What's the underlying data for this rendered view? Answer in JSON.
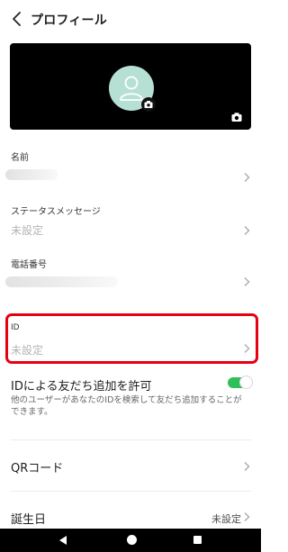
{
  "header": {
    "title": "プロフィール"
  },
  "profile": {
    "name": {
      "label": "名前"
    },
    "status": {
      "label": "ステータスメッセージ",
      "value": "未設定"
    },
    "phone": {
      "label": "電話番号"
    },
    "id": {
      "label": "ID",
      "value": "未設定"
    },
    "allow_id_search": {
      "label": "IDによる友だち追加を許可",
      "description": "他のユーザーがあなたのIDを検索して友だち追加することができます。",
      "enabled": true
    },
    "qr": {
      "label": "QRコード"
    },
    "birthday": {
      "label": "誕生日",
      "value": "未設定"
    }
  },
  "colors": {
    "toggle_on": "#2fbf5a",
    "highlight": "#e60012",
    "avatar_bg": "#b7e0d5"
  },
  "icons": [
    "back-arrow-icon",
    "user-silhouette-icon",
    "camera-icon",
    "chevron-right-icon"
  ]
}
